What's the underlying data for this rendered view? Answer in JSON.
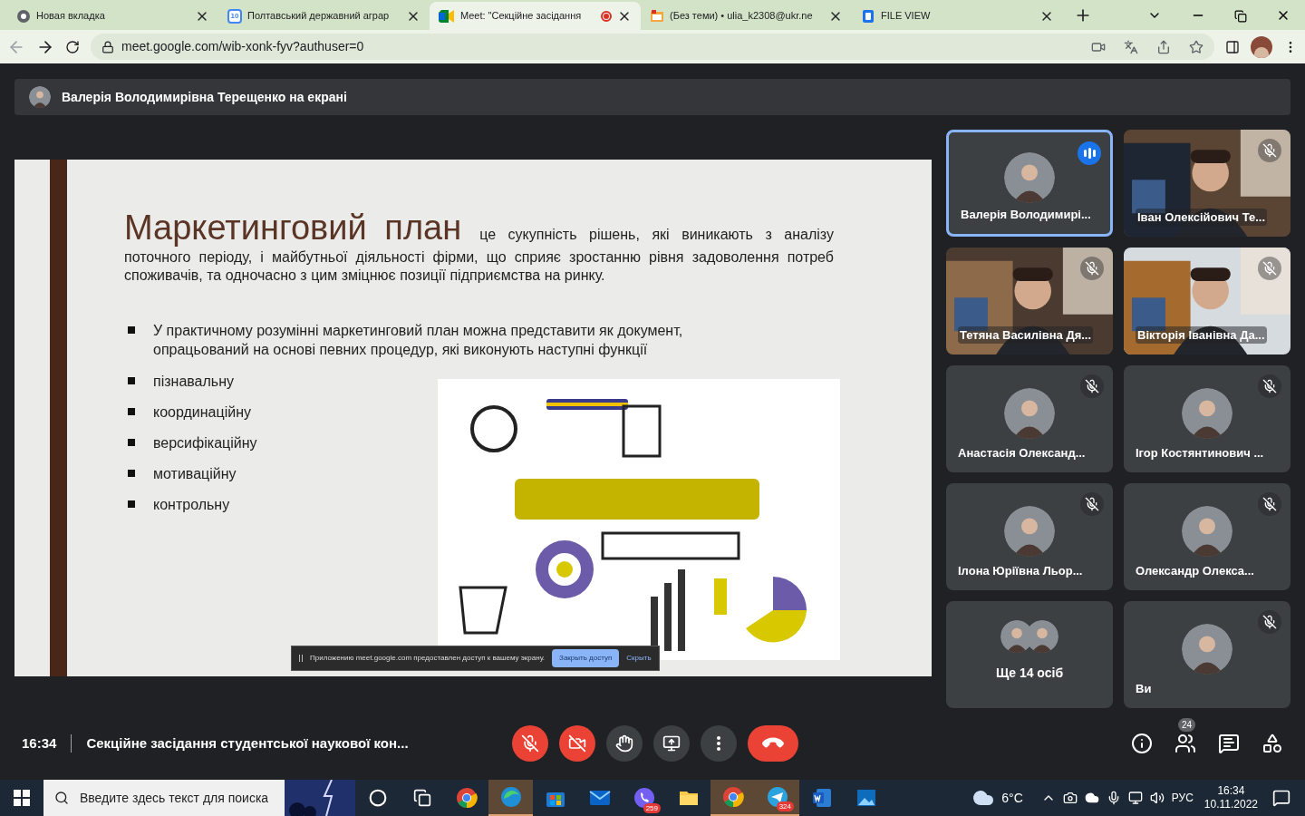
{
  "browser": {
    "tabs": [
      {
        "title": "Новая вкладка",
        "selected": false,
        "recording": false
      },
      {
        "title": "Полтавський державний аграр",
        "selected": false,
        "recording": false
      },
      {
        "title": "Meet: \"Секційне засідання",
        "selected": true,
        "recording": true
      },
      {
        "title": "(Без теми) • ulia_k2308@ukr.ne",
        "selected": false,
        "recording": false
      },
      {
        "title": "FILE VIEW",
        "selected": false,
        "recording": false
      }
    ],
    "calendar_day": "10",
    "address": "meet.google.com/wib-xonk-fyv?authuser=0"
  },
  "meet": {
    "presenter_banner": "Валерія Володимирівна Терещенко на екрані",
    "slide": {
      "heading": "Маркетинговий  план",
      "intro": "це сукупність рішень, які виникають з аналізу поточного періоду, і майбутньої діяльності фірми, що сприяє зростанню рівня задоволення потреб споживачів, та одночасно з цим зміцнює позиції підприємства на ринку.",
      "bullets": [
        "У практичному розумінні маркетинговий план можна представити як документ, опрацьований на основі певних процедур, які виконують наступні функції",
        "пізнавальну",
        "координаційну",
        "версифікаційну",
        "мотиваційну",
        "контрольну"
      ]
    },
    "share_notice": {
      "text": "Приложению meet.google.com предоставлен доступ к вашему экрану.",
      "stop_button": "Закрыть доступ",
      "hide_link": "Скрыть"
    },
    "participants": [
      {
        "name": "Валерія Володимирі...",
        "kind": "avatar",
        "muted": false,
        "speaking": true
      },
      {
        "name": "Іван Олексійович Те...",
        "kind": "video",
        "muted": true,
        "speaking": false
      },
      {
        "name": "Тетяна Василівна Дя...",
        "kind": "video",
        "muted": true,
        "speaking": false
      },
      {
        "name": "Вікторія Іванівна Да...",
        "kind": "video",
        "muted": true,
        "speaking": false
      },
      {
        "name": "Анастасія Олександ...",
        "kind": "avatar",
        "muted": true,
        "speaking": false
      },
      {
        "name": "Ігор Костянтинович ...",
        "kind": "avatar",
        "muted": true,
        "speaking": false
      },
      {
        "name": "Ілона Юріївна Льор...",
        "kind": "avatar",
        "muted": true,
        "speaking": false
      },
      {
        "name": "Олександр Олекса...",
        "kind": "avatar",
        "muted": true,
        "speaking": false
      },
      {
        "name": "Ще 14 осіб",
        "kind": "more",
        "muted": false,
        "speaking": false
      },
      {
        "name": "Ви",
        "kind": "avatar",
        "muted": true,
        "speaking": false
      }
    ],
    "time": "16:34",
    "meeting_title": "Секційне засідання студентської наукової кон...",
    "people_count": "24"
  },
  "taskbar": {
    "search_placeholder": "Введите здесь текст для поиска",
    "apps": [
      {
        "kind": "cortana",
        "active": false
      },
      {
        "kind": "taskview",
        "active": false
      },
      {
        "kind": "chrome",
        "active": false
      },
      {
        "kind": "edge",
        "active": true
      },
      {
        "kind": "store",
        "active": false
      },
      {
        "kind": "mail",
        "active": false
      },
      {
        "kind": "viber",
        "badge": "259",
        "active": false
      },
      {
        "kind": "explorer",
        "active": false
      },
      {
        "kind": "chrome",
        "active": true
      },
      {
        "kind": "telegram",
        "badge": "324",
        "active": true
      },
      {
        "kind": "word",
        "active": false
      },
      {
        "kind": "photos",
        "active": false
      }
    ],
    "weather": "6°C",
    "language": "РУС",
    "time": "16:34",
    "date": "10.11.2022"
  }
}
